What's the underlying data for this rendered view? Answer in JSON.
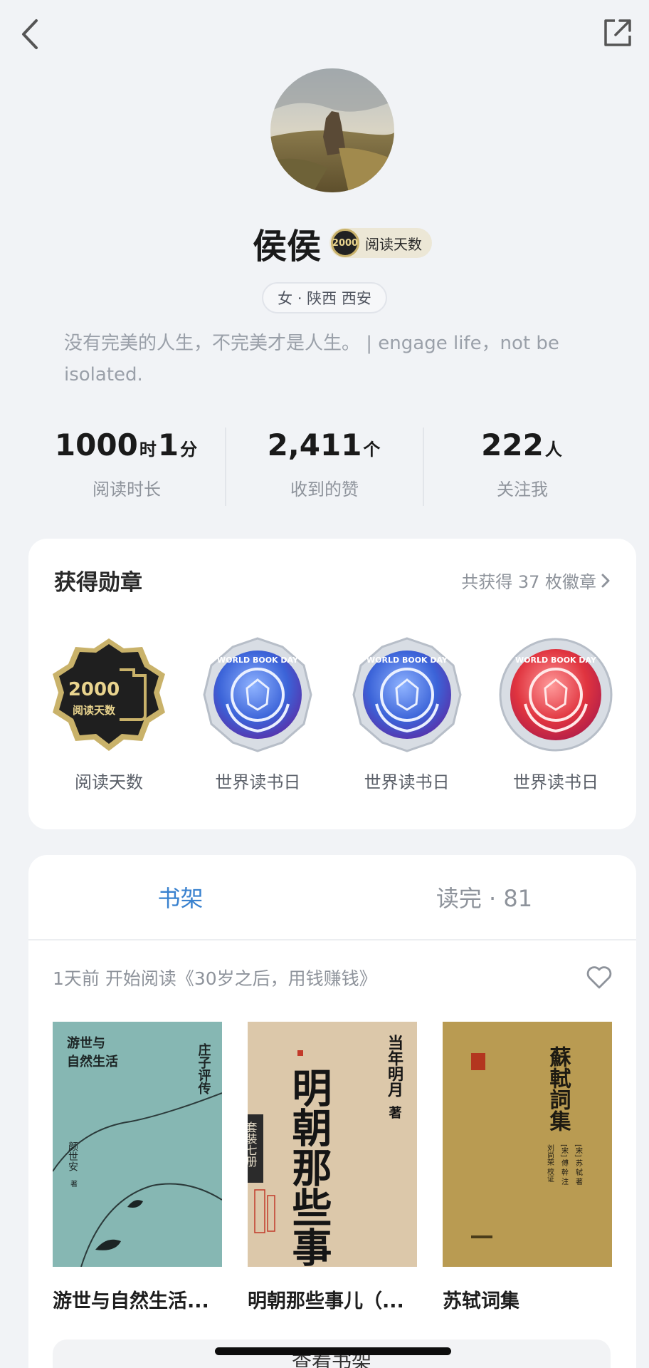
{
  "profile": {
    "name": "侯侯",
    "reading_badge": {
      "number": "2000",
      "label": "阅读天数"
    },
    "location": "女 · 陕西 西安",
    "bio": "没有完美的人生，不完美才是人生。 | engage life，not be isolated."
  },
  "stats": [
    {
      "value_1": "1000",
      "unit_1": "时",
      "value_2": "1",
      "unit_2": "分",
      "label": "阅读时长"
    },
    {
      "value_1": "2,411",
      "unit_1": "个",
      "label": "收到的赞"
    },
    {
      "value_1": "222",
      "unit_1": "人",
      "label": "关注我"
    }
  ],
  "medals": {
    "title": "获得勋章",
    "count_text": "共获得 37 枚徽章",
    "items": [
      {
        "label": "阅读天数",
        "badge_number": "2000",
        "badge_text": "阅读天数"
      },
      {
        "label": "世界读书日",
        "badge_text": "WORLD BOOK DAY"
      },
      {
        "label": "世界读书日",
        "badge_text": "WORLD BOOK DAY"
      },
      {
        "label": "世界读书日",
        "badge_text": "WORLD BOOK DAY"
      }
    ]
  },
  "shelf": {
    "tabs": [
      "书架",
      "读完 · 81"
    ],
    "activity": "1天前 开始阅读《30岁之后，用钱赚钱》",
    "books": [
      {
        "title": "游世与自然生活...",
        "cover_text": [
          "游世与",
          "自然生活",
          "庄子评传",
          "颜世安",
          "著"
        ]
      },
      {
        "title": "明朝那些事儿（...",
        "cover_text": [
          "明朝那些事儿",
          "当年明月",
          "著",
          "套装七册"
        ]
      },
      {
        "title": "苏轼词集",
        "cover_text": [
          "蘇軾詞集",
          "[宋] 苏 轼 著",
          "[宋] 傅 幹 注",
          "刘尚荣 校证"
        ]
      }
    ]
  },
  "bottom_button": "查看书架",
  "colors": {
    "accent": "#3a82cf",
    "background": "#f1f3f6",
    "card": "#ffffff",
    "muted_text": "#8e939b"
  },
  "icons": [
    "back-arrow-icon",
    "share-icon",
    "chevron-right-icon",
    "heart-outline-icon"
  ]
}
